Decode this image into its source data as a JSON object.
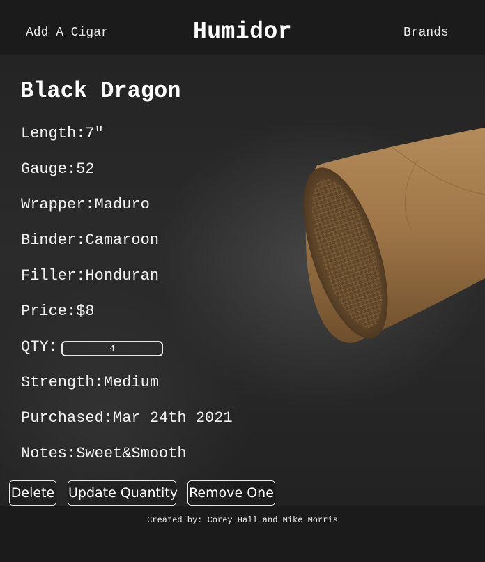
{
  "nav": {
    "add_label": "Add A Cigar",
    "title": "Humidor",
    "brands_label": "Brands"
  },
  "cigar": {
    "name": "Black Dragon",
    "length": "Length:7\"",
    "gauge": "Gauge:52",
    "wrapper": "Wrapper:Maduro",
    "binder": "Binder:Camaroon",
    "filler": "Filler:Honduran",
    "price": "Price:$8",
    "qty_label": "QTY:",
    "qty_value": "4",
    "strength": "Strength:Medium",
    "purchased": "Purchased:Mar 24th 2021",
    "notes": "Notes:Sweet&Smooth"
  },
  "actions": {
    "delete_label": "Delete",
    "update_label": "Update Quantity",
    "remove_label": "Remove One"
  },
  "footer": {
    "credit": "Created by: Corey Hall and Mike Morris"
  },
  "colors": {
    "nav_bg": "#1b1b1b",
    "page_bg": "#242424",
    "text": "#f2f2f2",
    "cigar_wrapper": "#a07a4c"
  }
}
